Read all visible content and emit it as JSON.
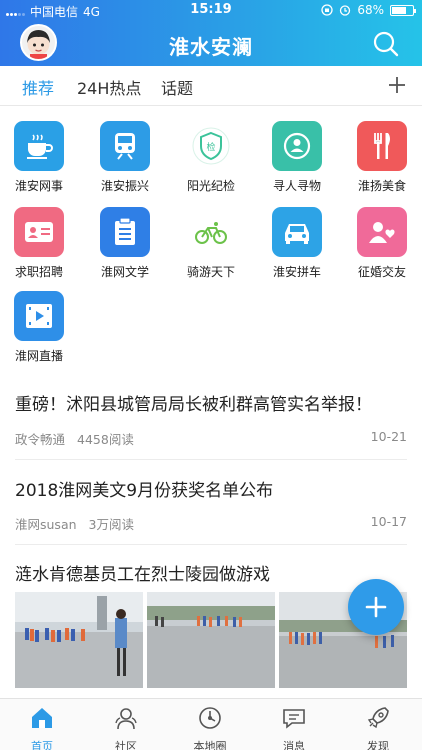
{
  "status_bar": {
    "carrier": "中国电信",
    "network": "4G",
    "time": "15:19",
    "battery": "68%",
    "battery_level": 0.68
  },
  "header": {
    "title": "淮水安澜"
  },
  "tabs": [
    {
      "label": "推荐",
      "active": true
    },
    {
      "label": "24H热点",
      "active": false
    },
    {
      "label": "话题",
      "active": false
    }
  ],
  "grid": [
    {
      "label": "淮安网事",
      "icon": "teacup-icon",
      "color": "#2aa0e6"
    },
    {
      "label": "淮安振兴",
      "icon": "train-icon",
      "color": "#2d9ce6"
    },
    {
      "label": "阳光纪检",
      "icon": "badge-icon",
      "color": "#3cc39a"
    },
    {
      "label": "寻人寻物",
      "icon": "person-search-icon",
      "color": "#39c0a8"
    },
    {
      "label": "淮扬美食",
      "icon": "fork-knife-icon",
      "color": "#f0595a"
    },
    {
      "label": "求职招聘",
      "icon": "id-card-icon",
      "color": "#f06a82"
    },
    {
      "label": "淮网文学",
      "icon": "document-icon",
      "color": "#2f7fe6"
    },
    {
      "label": "骑游天下",
      "icon": "bicycle-icon",
      "color": "#6cc24a"
    },
    {
      "label": "淮安拼车",
      "icon": "car-icon",
      "color": "#2da3e6"
    },
    {
      "label": "征婚交友",
      "icon": "couple-icon",
      "color": "#f06a99"
    },
    {
      "label": "淮网直播",
      "icon": "video-icon",
      "color": "#2e8fe8"
    }
  ],
  "articles": [
    {
      "title": "重磅！沭阳县城管局局长被利群高管实名举报！",
      "source": "政令畅通",
      "reads": "4458阅读",
      "date": "10-21"
    },
    {
      "title": "2018淮网美文9月份获奖名单公布",
      "source": "淮网susan",
      "reads": "3万阅读",
      "date": "10-17"
    },
    {
      "title": "涟水肯德基员工在烈士陵园做游戏"
    }
  ],
  "bottom_nav": [
    {
      "label": "首页",
      "icon": "home-icon",
      "active": true
    },
    {
      "label": "社区",
      "icon": "community-icon",
      "active": false
    },
    {
      "label": "本地圈",
      "icon": "local-circle-icon",
      "active": false
    },
    {
      "label": "消息",
      "icon": "message-icon",
      "active": false
    },
    {
      "label": "发现",
      "icon": "rocket-icon",
      "active": false
    }
  ]
}
